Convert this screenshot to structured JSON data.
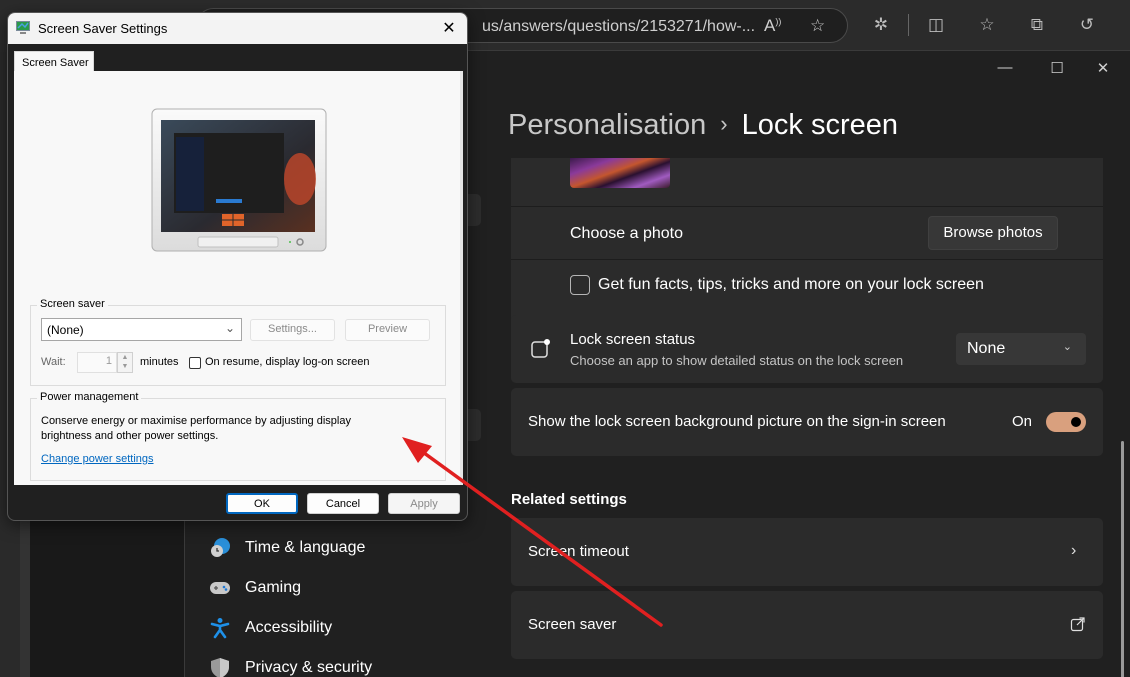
{
  "browser": {
    "address_text": "us/answers/questions/2153271/how-...",
    "toolbar_icons": [
      "read-aloud-icon",
      "favorite-star-icon",
      "extensions-icon",
      "split-screen-icon",
      "favorites-icon",
      "collections-icon",
      "history-icon"
    ]
  },
  "settings": {
    "window_controls": {
      "minimize": "—",
      "maximize": "☐",
      "close": "✕"
    },
    "breadcrumb": {
      "parent": "Personalisation",
      "separator": "›",
      "current": "Lock screen"
    },
    "choose_photo": {
      "label": "Choose a photo",
      "button": "Browse photos"
    },
    "fun_facts": {
      "label": "Get fun facts, tips, tricks and more on your lock screen",
      "checked": false
    },
    "lock_status": {
      "title": "Lock screen status",
      "subtitle": "Choose an app to show detailed status on the lock screen",
      "value": "None"
    },
    "signin_bg": {
      "label": "Show the lock screen background picture on the sign-in screen",
      "state": "On",
      "on": true,
      "accent": "#d9a07e"
    },
    "related": {
      "title": "Related settings",
      "items": [
        {
          "label": "Screen timeout",
          "icon": "chevron-right-icon"
        },
        {
          "label": "Screen saver",
          "icon": "external-link-icon"
        }
      ]
    },
    "nav": [
      {
        "label": "Time & language",
        "icon": "globe-clock-icon"
      },
      {
        "label": "Gaming",
        "icon": "gamepad-icon"
      },
      {
        "label": "Accessibility",
        "icon": "accessibility-icon"
      },
      {
        "label": "Privacy & security",
        "icon": "shield-icon"
      }
    ]
  },
  "dialog": {
    "title": "Screen Saver Settings",
    "close": "✕",
    "tab": "Screen Saver",
    "screen_saver_group": {
      "label": "Screen saver",
      "selected": "(None)",
      "settings_button": "Settings...",
      "preview_button": "Preview",
      "wait_label": "Wait:",
      "wait_value": "1",
      "minutes_label": "minutes",
      "resume_label": "On resume, display log-on screen",
      "resume_checked": false
    },
    "power_group": {
      "label": "Power management",
      "description_line1": "Conserve energy or maximise performance by adjusting display",
      "description_line2": "brightness and other power settings.",
      "link": "Change power settings"
    },
    "buttons": {
      "ok": "OK",
      "cancel": "Cancel",
      "apply": "Apply"
    }
  },
  "annotation": {
    "arrow_color": "#e02020"
  }
}
